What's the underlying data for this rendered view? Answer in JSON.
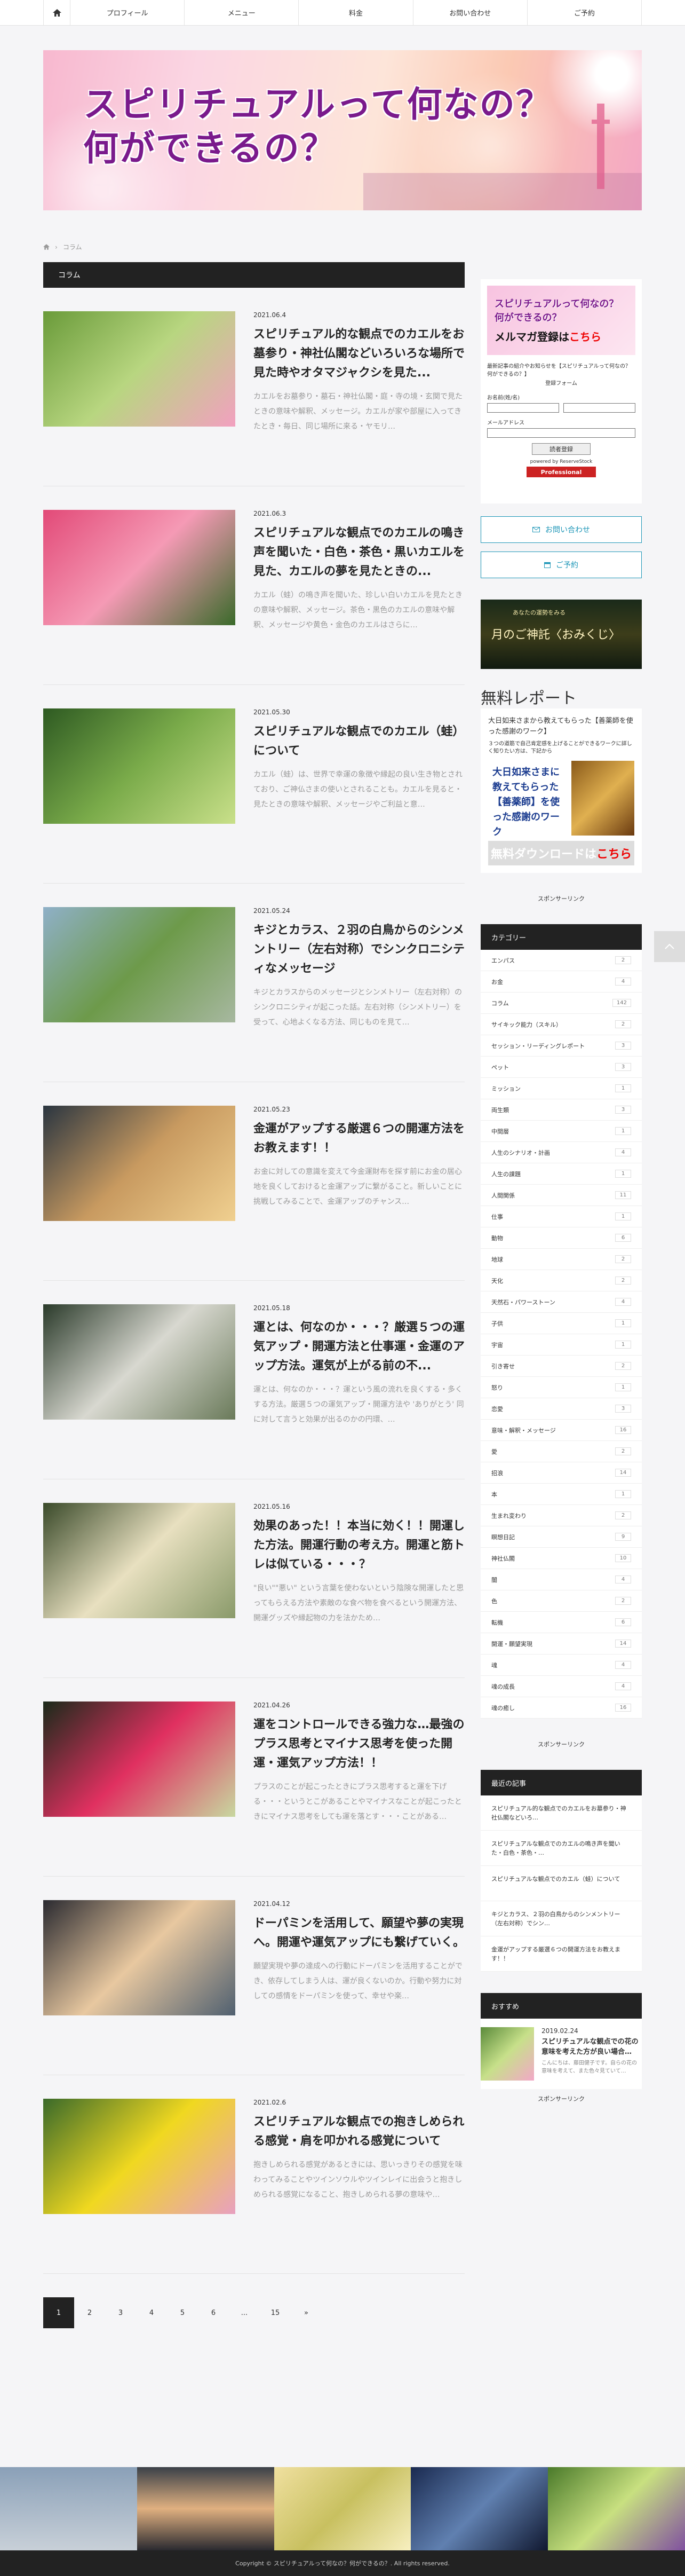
{
  "nav": {
    "items": [
      {
        "label": "プロフィール"
      },
      {
        "label": "メニュー"
      },
      {
        "label": "料金"
      },
      {
        "label": "お問い合わせ"
      },
      {
        "label": "ご予約"
      }
    ]
  },
  "hero": {
    "line1": "スピリチュアルって何なの？",
    "line2": "何ができるの？"
  },
  "breadcrumb": {
    "current": "コラム"
  },
  "category_title": "コラム",
  "articles": [
    {
      "date": "2021.06.4",
      "title": "スピリチュアル的な観点でのカエルをお墓参り・神社仏閣などいろいろな場所で見た時やオタマジャクシを見た...",
      "excerpt": "カエルをお墓参り・墓石・神社仏閣・庭・寺の境・玄関で見たときの意味や解釈、メッセージ。カエルが家や部屋に入ってきたとき・毎日、同じ場所に来る・ヤモリ…",
      "colors": [
        "#6a9b3a",
        "#b8d680",
        "#f2a0c0"
      ]
    },
    {
      "date": "2021.06.3",
      "title": "スピリチュアルな観点でのカエルの鳴き声を聞いた・白色・茶色・黒いカエルを見た、カエルの夢を見たときの...",
      "excerpt": "カエル（蛙）の鳴き声を聞いた、珍しい白いカエルを見たときの意味や解釈、メッセージ。茶色・黒色のカエルの意味や解釈、メッセージや黄色・金色のカエルはさらに…",
      "colors": [
        "#e24a78",
        "#f59ab5",
        "#3a6a2a"
      ]
    },
    {
      "date": "2021.05.30",
      "title": "スピリチュアルな観点でのカエル（蛙）について",
      "excerpt": "カエル（蛙）は、世界で幸運の象徴や縁起の良い生き物とされており、ご神仏さまの使いとされることも。カエルを見ると・見たときの意味や解釈、メッセージやご利益と意…",
      "colors": [
        "#2e5a22",
        "#7aab4a",
        "#c9e08a"
      ]
    },
    {
      "date": "2021.05.24",
      "title": "キジとカラス、２羽の白鳥からのシンメントリー（左右対称）でシンクロニシティなメッセージ",
      "excerpt": "キジとカラスからのメッセージとシンメトリー（左右対称）のシンクロニシティが起こった話。左右対称（シンメトリー）を受って、心地よくなる方法、同じものを見て…",
      "colors": [
        "#8fb0c8",
        "#6d9a4a",
        "#a7b8a0"
      ]
    },
    {
      "date": "2021.05.23",
      "title": "金運がアップする厳選６つの開運方法をお教えます！！",
      "excerpt": "お金に対しての意識を変えて今金運財布を探す前にお金の居心地を良くしておけると金運アップに繋がること。新しいことに挑戦してみることで、金運アップのチャンス…",
      "colors": [
        "#2a3540",
        "#c89a60",
        "#f0d090"
      ]
    },
    {
      "date": "2021.05.18",
      "title": "運とは、何なのか・・・？厳選５つの運気アップ・開運方法と仕事運・金運のアップ方法。運気が上がる前の不...",
      "excerpt": "運とは、何なのか・・・？運という風の流れを良くする・多くする方法。厳選５つの運気アップ・開運方法や 'ありがとう' 同に対して言うと効果が出るのかの円環、…",
      "colors": [
        "#2a3a2a",
        "#d8d8d0",
        "#6a7a5a"
      ]
    },
    {
      "date": "2021.05.16",
      "title": "効果のあった！！本当に効く！！開運した方法。開運行動の考え方。開運と筋トレは似ている・・・？",
      "excerpt": "\"良い\"\"悪い\" という言葉を使わないという陰険な開運したと思ってもらえる方法や素敵のな食べ物を食べるという開運方法、開運グッズや縁起物の力を法かため…",
      "colors": [
        "#3a4a2a",
        "#e8e0c0",
        "#8a9a6a"
      ]
    },
    {
      "date": "2021.04.26",
      "title": "運をコントロールできる強力な…最強のプラス思考とマイナス思考を使った開運・運気アップ方法！！",
      "excerpt": "プラスのことが起こったときにプラス思考すると運を下げる・・・というとこがあることやマイナスなことが起こったときにマイナス思考をしても運を落とす・・・ことがある…",
      "colors": [
        "#1a2a1a",
        "#e03060",
        "#c8d8a0"
      ]
    },
    {
      "date": "2021.04.12",
      "title": "ドーパミンを活用して、願望や夢の実現へ。開運や運気アップにも繋げていく。",
      "excerpt": "願望実現や夢の達成への行動にドーパミンを活用することができ、依存してしまう人は、運が良くないのか。行動や努力に対しての感情をドーパミンを使って、幸せや楽…",
      "colors": [
        "#2a2a30",
        "#e8c8a0",
        "#506070"
      ]
    },
    {
      "date": "2021.02.6",
      "title": "スピリチュアルな観点での抱きしめられる感覚・肩を叩かれる感覚について",
      "excerpt": "抱きしめられる感覚があるときには、思いっきりその感覚を味わってみることやツインソウルやツインレイに出会うと抱きしめられる感覚になること、抱きしめられる夢の意味や…",
      "colors": [
        "#3a6a2a",
        "#f0d820",
        "#e8a0c0"
      ]
    }
  ],
  "pagination": [
    "1",
    "2",
    "3",
    "4",
    "5",
    "6",
    "...",
    "15",
    "»"
  ],
  "sidebar": {
    "ad": {
      "banner_line1": "スピリチュアルって何なの？",
      "banner_line1b": "何ができるの？",
      "banner_line2a": "メルマガ",
      "banner_line2b": "登録は",
      "banner_line2c": "こちら",
      "text": "最新記事の紹介やお知らせを【スピリチュアルって何なの？ 何ができるの？】",
      "subtitle": "登録フォーム",
      "name_label": "お名前(姓/名)",
      "email_label": "メールアドレス",
      "submit": "読者登録",
      "powered": "powered by ReserveStock",
      "pro": "Professional"
    },
    "contact_btn": "お問い合わせ",
    "reserve_btn": "ご予約",
    "omikuji": {
      "s1": "あなたの運勢をみる",
      "s2": "月のご神託〈おみくじ〉",
      "s3": ""
    },
    "report": {
      "title": "無料レポート",
      "text": "大日如来さまから教えてもらった【善薬師を使った感謝のワーク】",
      "small": "３つの道筋で自己肯定感を上げることができるワークに詳しく知りたい方は、下記から",
      "img_text": "大日如来さまに教えてもらった【善薬師】を使った感謝のワーク",
      "dl_a": "無料ダウンロードは",
      "dl_b": "こちら"
    },
    "sponsor": "スポンサーリンク",
    "category_head": "カテゴリー",
    "categories": [
      {
        "name": "エンパス",
        "count": "2"
      },
      {
        "name": "お金",
        "count": "4"
      },
      {
        "name": "コラム",
        "count": "142"
      },
      {
        "name": "サイキック能力（スキル）",
        "count": "2"
      },
      {
        "name": "セッション・リーディングレポート",
        "count": "3"
      },
      {
        "name": "ペット",
        "count": "3"
      },
      {
        "name": "ミッション",
        "count": "1"
      },
      {
        "name": "両生類",
        "count": "3"
      },
      {
        "name": "中間層",
        "count": "1"
      },
      {
        "name": "人生のシナリオ・計画",
        "count": "4"
      },
      {
        "name": "人生の課題",
        "count": "1"
      },
      {
        "name": "人間関係",
        "count": "11"
      },
      {
        "name": "仕事",
        "count": "1"
      },
      {
        "name": "動物",
        "count": "6"
      },
      {
        "name": "地球",
        "count": "2"
      },
      {
        "name": "天化",
        "count": "2"
      },
      {
        "name": "天然石・パワーストーン",
        "count": "4"
      },
      {
        "name": "子供",
        "count": "1"
      },
      {
        "name": "宇宙",
        "count": "1"
      },
      {
        "name": "引き寄せ",
        "count": "2"
      },
      {
        "name": "怒り",
        "count": "1"
      },
      {
        "name": "恋愛",
        "count": "3"
      },
      {
        "name": "意味・解釈・メッセージ",
        "count": "16"
      },
      {
        "name": "愛",
        "count": "2"
      },
      {
        "name": "招浪",
        "count": "14"
      },
      {
        "name": "本",
        "count": "1"
      },
      {
        "name": "生まれ変わり",
        "count": "2"
      },
      {
        "name": "瞑想日記",
        "count": "9"
      },
      {
        "name": "神社仏閣",
        "count": "10"
      },
      {
        "name": "闇",
        "count": "4"
      },
      {
        "name": "色",
        "count": "2"
      },
      {
        "name": "転機",
        "count": "6"
      },
      {
        "name": "開運・願望実現",
        "count": "14"
      },
      {
        "name": "魂",
        "count": "4"
      },
      {
        "name": "魂の成長",
        "count": "4"
      },
      {
        "name": "魂の癒し",
        "count": "16"
      }
    ],
    "sponsor2": "スポンサーリンク",
    "recent_head": "最近の記事",
    "recent": [
      "スピリチュアル的な観点でのカエルをお墓参り・神社仏閣などいろ…",
      "スピリチュアルな観点でのカエルの鳴き声を聞いた・白色・茶色・…",
      "スピリチュアルな観点でのカエル（蛙）について",
      "キジとカラス、２羽の白鳥からのシンメントリー（左右対称）でシン…",
      "金運がアップする厳選６つの開運方法をお教えます！！"
    ],
    "pick_head": "おすすめ",
    "pick": {
      "date": "2019.02.24",
      "title": "スピリチュアルな観点での花の意味を考えた方が良い場合…",
      "excerpt": "こんにちは、藤田健子です。自らの花の意味を考えて、また色々見ていて…"
    },
    "sponsor3": "スポンサーリンク"
  },
  "footer": {
    "copyright": "Copyright ©  スピリチュアルって何なの？何ができるの？. All rights reserved."
  }
}
